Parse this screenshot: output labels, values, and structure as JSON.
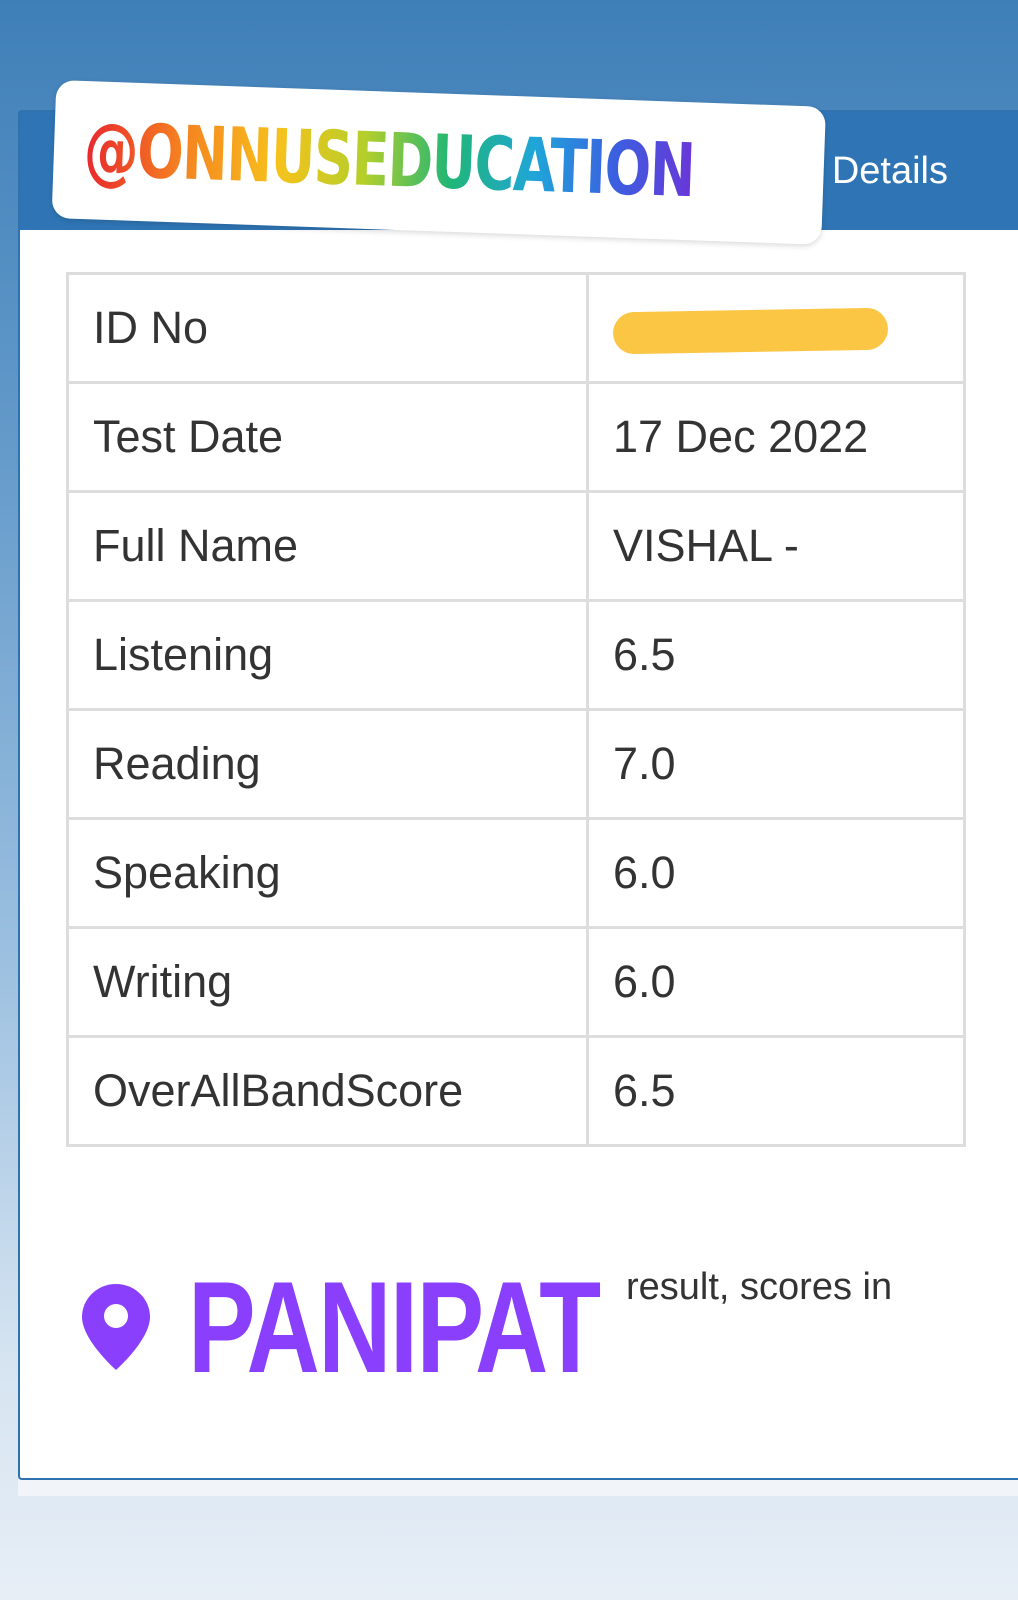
{
  "header": {
    "title": "Details"
  },
  "sticker": {
    "text": "@ONNUSEDUCATION",
    "icon": "threads-icon"
  },
  "result_rows": [
    {
      "label": "ID No",
      "value": ""
    },
    {
      "label": "Test Date",
      "value": "17 Dec 2022"
    },
    {
      "label": "Full Name",
      "value": "VISHAL -"
    },
    {
      "label": "Listening",
      "value": "6.5"
    },
    {
      "label": "Reading",
      "value": "7.0"
    },
    {
      "label": "Speaking",
      "value": "6.0"
    },
    {
      "label": "Writing",
      "value": "6.0"
    },
    {
      "label": "OverAllBandScore",
      "value": "6.5"
    }
  ],
  "location": {
    "icon": "map-pin-icon",
    "text": "PANIPAT"
  },
  "footer_note": "result, scores in",
  "colors": {
    "header_blue": "#2f75b5",
    "location_purple": "#8a3ffc",
    "redaction_yellow": "#fcc645"
  }
}
